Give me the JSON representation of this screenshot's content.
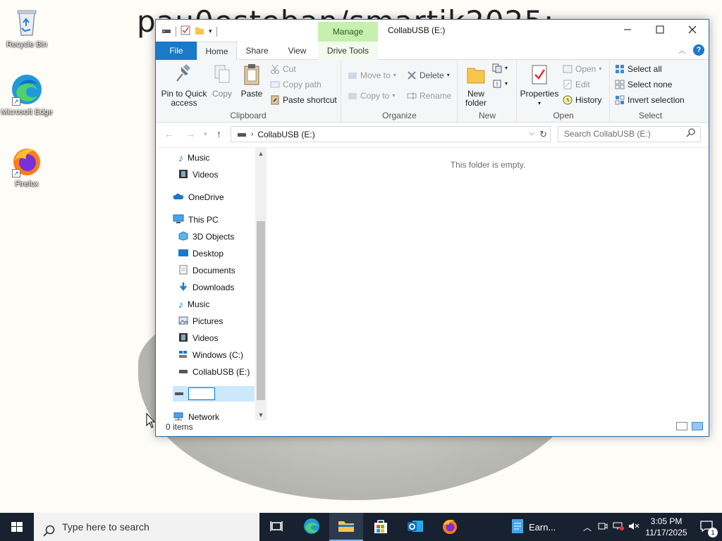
{
  "desktop": {
    "wallpaper_text": "pau0esteban/smartik2025:",
    "icons": [
      {
        "label": "Recycle Bin"
      },
      {
        "label": "Microsoft Edge"
      },
      {
        "label": "Firefox"
      }
    ]
  },
  "window": {
    "title": "CollabUSB (E:)",
    "context_tab": "Manage",
    "tabs": {
      "file": "File",
      "home": "Home",
      "share": "Share",
      "view": "View",
      "drive_tools": "Drive Tools"
    },
    "ribbon": {
      "clipboard": {
        "label": "Clipboard",
        "pin": "Pin to Quick access",
        "copy": "Copy",
        "paste": "Paste",
        "cut": "Cut",
        "copy_path": "Copy path",
        "paste_shortcut": "Paste shortcut"
      },
      "organize": {
        "label": "Organize",
        "move_to": "Move to",
        "copy_to": "Copy to",
        "delete": "Delete",
        "rename": "Rename"
      },
      "new": {
        "label": "New",
        "new_folder": "New folder"
      },
      "open": {
        "label": "Open",
        "properties": "Properties",
        "open": "Open",
        "edit": "Edit",
        "history": "History"
      },
      "select": {
        "label": "Select",
        "select_all": "Select all",
        "select_none": "Select none",
        "invert_selection": "Invert selection"
      }
    },
    "address": {
      "path": "CollabUSB (E:)",
      "search_placeholder": "Search CollabUSB (E:)"
    },
    "nav_pane": {
      "items": [
        {
          "label": "Music"
        },
        {
          "label": "Videos"
        },
        {
          "label": "OneDrive"
        },
        {
          "label": "This PC"
        },
        {
          "label": "3D Objects"
        },
        {
          "label": "Desktop"
        },
        {
          "label": "Documents"
        },
        {
          "label": "Downloads"
        },
        {
          "label": "Music"
        },
        {
          "label": "Pictures"
        },
        {
          "label": "Videos"
        },
        {
          "label": "Windows (C:)"
        },
        {
          "label": "CollabUSB (E:)"
        },
        {
          "label": ""
        },
        {
          "label": "Network"
        }
      ],
      "rename_value": ""
    },
    "main": {
      "empty_message": "This folder is empty."
    },
    "status": {
      "items": "0 items"
    }
  },
  "taskbar": {
    "search_placeholder": "Type here to search",
    "pinned_label": "Earn...",
    "time": "3:05 PM",
    "date": "11/17/2025",
    "notification_count": "1"
  },
  "colors": {
    "accent": "#1979ca",
    "manage_tab": "#c6efb0",
    "taskbar": "#18212f",
    "selection": "#cce8ff"
  }
}
